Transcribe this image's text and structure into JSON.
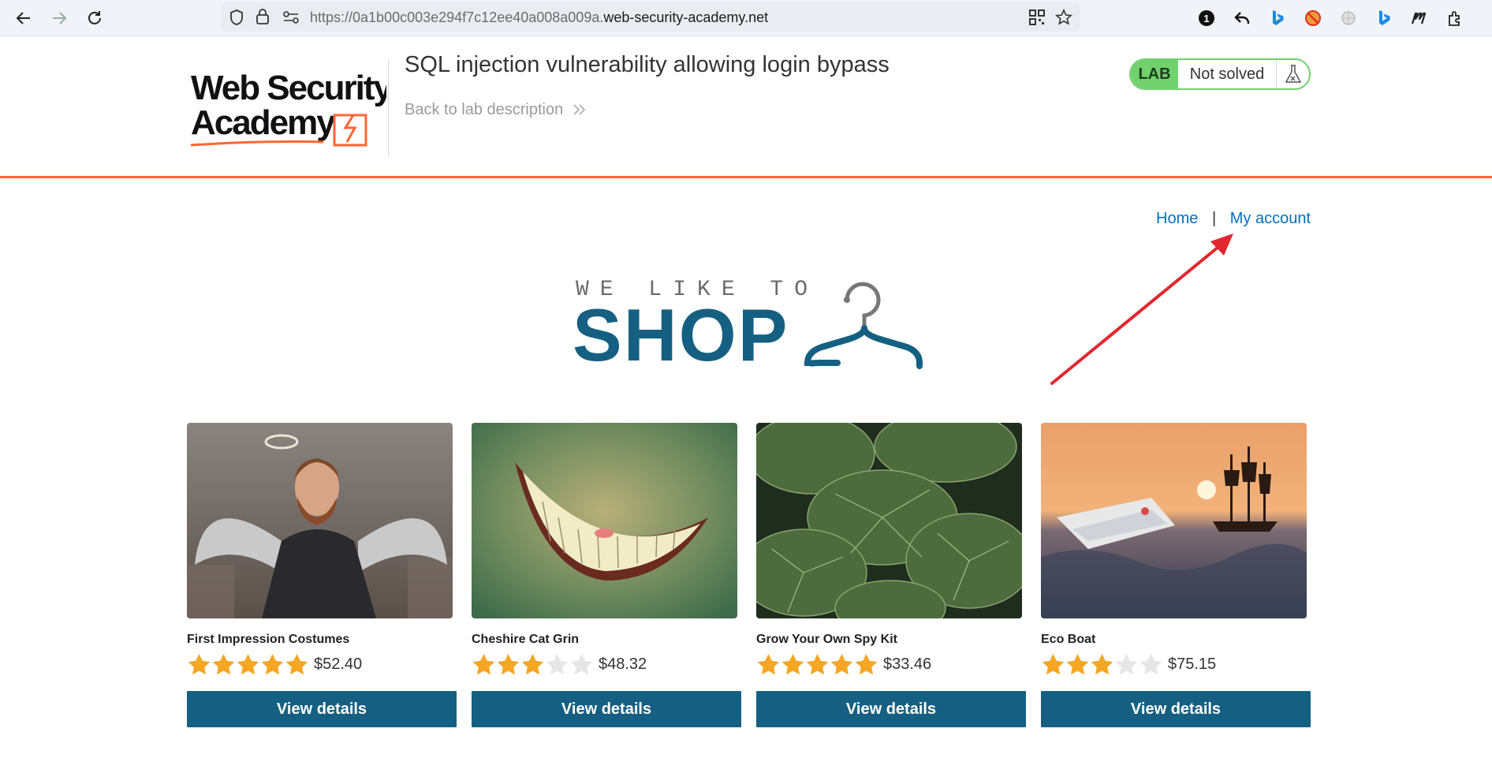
{
  "browser": {
    "url_prefix": "https://0a1b00c003e294f7c12ee40a008a009a.",
    "url_domain": "web-security-academy.net",
    "ext_badge": "1"
  },
  "lab": {
    "logo_line1": "Web Security",
    "logo_line2": "Academy",
    "title": "SQL injection vulnerability allowing login bypass",
    "back_link": "Back to lab description",
    "badge": "LAB",
    "status": "Not solved"
  },
  "nav": {
    "home": "Home",
    "separator": "|",
    "account": "My account"
  },
  "shop_logo": {
    "tagline": "WE LIKE TO",
    "word": "SHOP"
  },
  "colors": {
    "accent_orange": "#ff6633",
    "brand_blue": "#156082",
    "lab_green": "#70d16d",
    "link_blue": "#0071bc",
    "star_filled": "#f5a623",
    "star_empty": "#e6e6e6",
    "annotation_red": "#e0282e"
  },
  "products": [
    {
      "name": "First Impression Costumes",
      "rating": 5,
      "price": "$52.40",
      "button": "View details"
    },
    {
      "name": "Cheshire Cat Grin",
      "rating": 3,
      "price": "$48.32",
      "button": "View details"
    },
    {
      "name": "Grow Your Own Spy Kit",
      "rating": 5,
      "price": "$33.46",
      "button": "View details"
    },
    {
      "name": "Eco Boat",
      "rating": 3,
      "price": "$75.15",
      "button": "View details"
    }
  ]
}
